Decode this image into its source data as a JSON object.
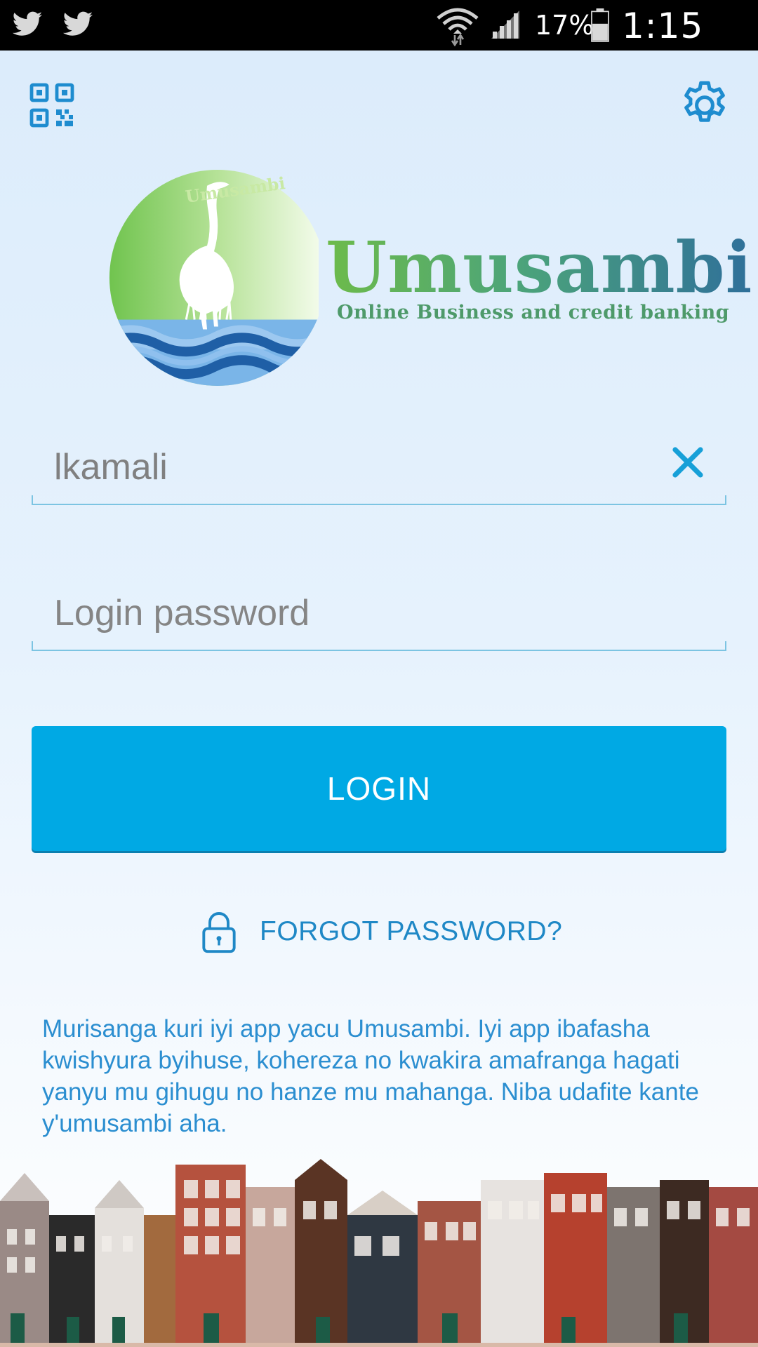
{
  "status_bar": {
    "notifications": [
      "twitter-icon",
      "twitter-icon"
    ],
    "battery_percent": "17%",
    "time": "1:15 PM"
  },
  "toolbar": {
    "left_icon": "qr-code-icon",
    "right_icon": "gear-icon"
  },
  "brand": {
    "name": "Umusambi",
    "tagline": "Online Business and credit banking",
    "badge_text": "Umusambi"
  },
  "form": {
    "username_value": "lkamali",
    "password_placeholder": "Login password",
    "login_label": "LOGIN",
    "forgot_label": "FORGOT PASSWORD?"
  },
  "welcome_text": "Murisanga kuri iyi app yacu Umusambi. Iyi app ibafasha kwishyura byihuse, kohereza no kwakira amafranga hagati yanyu mu gihugu no hanze mu mahanga. Niba udafite kante y'umusambi aha.",
  "colors": {
    "accent": "#00a9e4",
    "link": "#1f88c6",
    "background": "#e0effc",
    "field_line": "#7cc4e2"
  }
}
